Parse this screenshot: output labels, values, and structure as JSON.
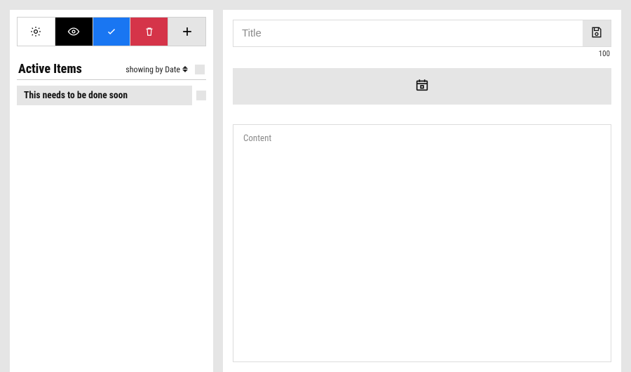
{
  "sidebar": {
    "section_title": "Active Items",
    "sort_label": "showing by Date",
    "items": [
      {
        "title": "This needs to be done soon"
      }
    ]
  },
  "editor": {
    "title_value": "",
    "title_placeholder": "Title",
    "char_counter": "100",
    "content_value": "",
    "content_placeholder": "Content"
  },
  "colors": {
    "tab_black": "#000000",
    "tab_blue": "#1976f2",
    "tab_red": "#d53449",
    "panel_grey": "#e5e5e5"
  }
}
